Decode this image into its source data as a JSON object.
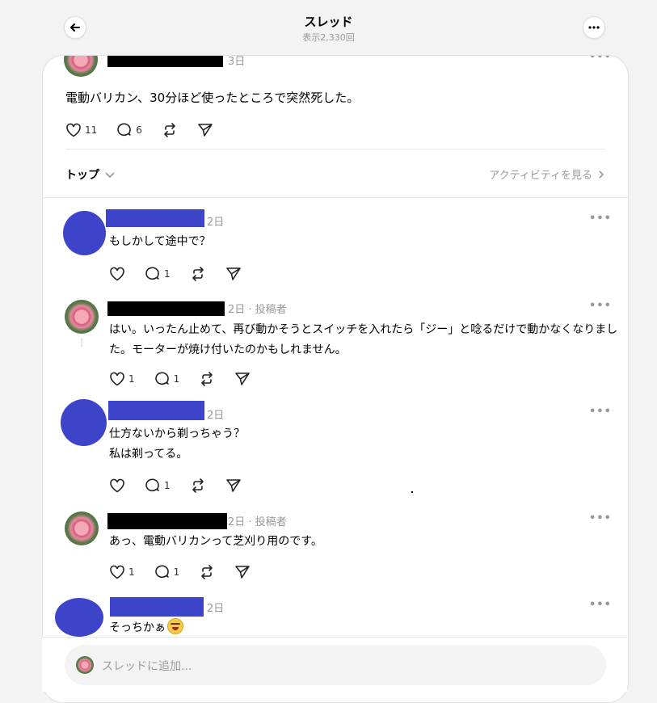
{
  "header": {
    "title": "スレッド",
    "views": "表示2,330回"
  },
  "main_post": {
    "time": "3日",
    "text": "電動バリカン、30分ほど使ったところで突然死した。",
    "likes": "11",
    "comments": "6"
  },
  "sort": {
    "label": "トップ",
    "activity_link": "アクティビティを見る"
  },
  "replies": [
    {
      "time": "2日",
      "text_lines": [
        "もしかして途中で？"
      ],
      "likes": "",
      "comments": "1"
    },
    {
      "time": "2日 · 投稿者",
      "text_lines": [
        "はい。いったん止めて、再び動かそうとスイッチを入れたら「ジー」と唸るだけで動かなくなりまし",
        "た。モーターが焼け付いたのかもしれません。"
      ],
      "likes": "1",
      "comments": "1"
    },
    {
      "time": "2日",
      "text_lines": [
        "仕方ないから剃っちゃう？",
        "私は剃ってる。"
      ],
      "likes": "",
      "comments": "1"
    },
    {
      "time": "2日 · 投稿者",
      "text_lines": [
        "あっ、電動バリカンって芝刈り用のです。"
      ],
      "likes": "1",
      "comments": "1"
    },
    {
      "time": "2日",
      "text_lines": [
        "そっちかぁ"
      ],
      "likes": "",
      "comments": ""
    }
  ],
  "reply_bar": {
    "placeholder": "スレッドに追加..."
  },
  "icons": {
    "back": "arrow-left-icon",
    "more": "more-horizontal-icon",
    "like": "heart-icon",
    "comment": "comment-icon",
    "repost": "repost-icon",
    "share": "send-icon"
  },
  "colors": {
    "redaction_blue": "#3d44c9",
    "redaction_black": "#000000",
    "muted": "#999999"
  }
}
